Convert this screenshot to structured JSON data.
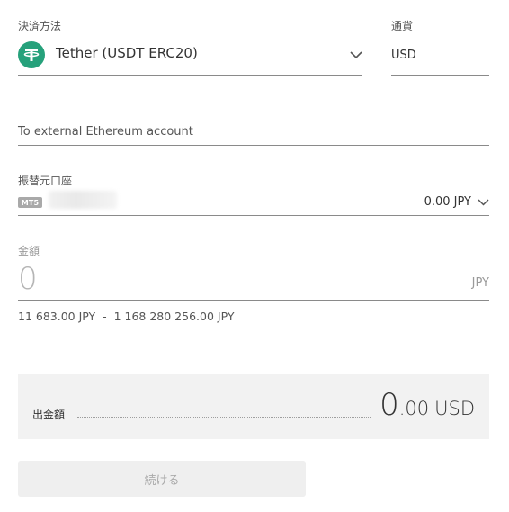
{
  "payment_method": {
    "label": "決済方法",
    "value": "Tether (USDT ERC20)",
    "icon": "tether-icon",
    "icon_color": "#26a17b"
  },
  "currency": {
    "label": "通貨",
    "value": "USD"
  },
  "destination": {
    "value": "To external Ethereum account"
  },
  "source_account": {
    "label": "振替元口座",
    "badge": "MT5",
    "balance": "0.00 JPY"
  },
  "amount": {
    "label": "金額",
    "value": "0",
    "unit": "JPY",
    "range": "11 683.00 JPY  -  1 168 280 256.00 JPY"
  },
  "payout": {
    "label": "出金額",
    "value_int": "0",
    "value_dec": ".00",
    "currency": "USD"
  },
  "continue_button": {
    "label": "続ける"
  }
}
